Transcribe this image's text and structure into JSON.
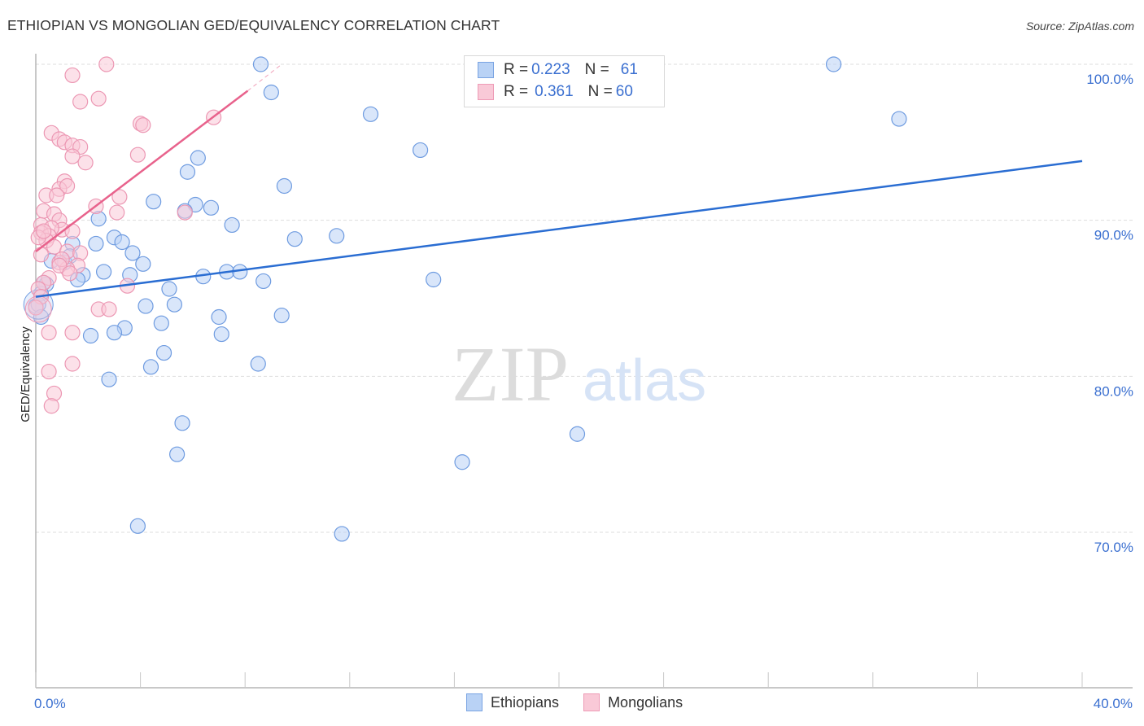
{
  "header": {
    "title": "ETHIOPIAN VS MONGOLIAN GED/EQUIVALENCY CORRELATION CHART",
    "source": "Source: ZipAtlas.com"
  },
  "watermark": {
    "zip": "ZIP",
    "atlas": "atlas"
  },
  "legend": {
    "rows": [
      {
        "r_label": "R = ",
        "r_value": "0.223",
        "n_label": "N = ",
        "n_value": "61"
      },
      {
        "r_label": "R = ",
        "r_value": "0.361",
        "n_label": "N = ",
        "n_value": "60"
      }
    ]
  },
  "colors": {
    "ethiopians_fill": "#b9d2f5",
    "ethiopians_stroke": "#6e9be0",
    "ethiopians_line": "#2a6dd2",
    "mongolians_fill": "#f9c9d7",
    "mongolians_stroke": "#ec97b3",
    "mongolians_line": "#e8628c",
    "axis_text": "#3a6fd0",
    "grid": "#dddddd"
  },
  "chart_data": {
    "type": "scatter",
    "title": "ETHIOPIAN VS MONGOLIAN GED/EQUIVALENCY CORRELATION CHART",
    "xlabel": "",
    "ylabel": "GED/Equivalency",
    "xlim": [
      0,
      40
    ],
    "ylim": [
      60.7,
      101.2
    ],
    "x_tick_labels": [
      {
        "value": 0,
        "label": "0.0%"
      },
      {
        "value": 40,
        "label": "40.0%"
      }
    ],
    "x_minor_ticks": [
      0,
      4,
      8,
      12,
      16,
      20,
      24,
      28,
      32,
      36,
      40
    ],
    "y_ticks": [
      {
        "value": 100,
        "label": "100.0%"
      },
      {
        "value": 90,
        "label": "90.0%"
      },
      {
        "value": 80,
        "label": "80.0%"
      },
      {
        "value": 70,
        "label": "70.0%"
      }
    ],
    "grid": true,
    "legend_position": "top-center",
    "bottom_legend": [
      "Ethiopians",
      "Mongolians"
    ],
    "series": [
      {
        "name": "Ethiopians",
        "R": 0.223,
        "N": 61,
        "trend": {
          "x": [
            0,
            40
          ],
          "y": [
            85.1,
            93.8
          ]
        },
        "points": [
          [
            8.6,
            100.0
          ],
          [
            9.0,
            98.2
          ],
          [
            12.8,
            96.8
          ],
          [
            30.5,
            100.0
          ],
          [
            33.0,
            96.5
          ],
          [
            14.7,
            94.5
          ],
          [
            6.2,
            94.0
          ],
          [
            5.8,
            93.1
          ],
          [
            9.5,
            92.2
          ],
          [
            4.5,
            91.2
          ],
          [
            6.1,
            91.0
          ],
          [
            5.7,
            90.6
          ],
          [
            6.7,
            90.8
          ],
          [
            2.4,
            90.1
          ],
          [
            7.5,
            89.7
          ],
          [
            9.9,
            88.8
          ],
          [
            11.5,
            89.0
          ],
          [
            3.0,
            88.9
          ],
          [
            3.3,
            88.6
          ],
          [
            2.3,
            88.5
          ],
          [
            1.4,
            88.5
          ],
          [
            3.7,
            87.9
          ],
          [
            4.1,
            87.2
          ],
          [
            0.6,
            87.4
          ],
          [
            1.1,
            87.3
          ],
          [
            1.8,
            86.5
          ],
          [
            2.6,
            86.7
          ],
          [
            3.6,
            86.5
          ],
          [
            1.6,
            86.2
          ],
          [
            6.4,
            86.4
          ],
          [
            7.3,
            86.7
          ],
          [
            7.8,
            86.7
          ],
          [
            8.7,
            86.1
          ],
          [
            15.2,
            86.2
          ],
          [
            0.4,
            85.9
          ],
          [
            0.2,
            85.3
          ],
          [
            5.1,
            85.6
          ],
          [
            0.0,
            84.5
          ],
          [
            4.2,
            84.5
          ],
          [
            5.3,
            84.6
          ],
          [
            4.8,
            83.4
          ],
          [
            7.0,
            83.8
          ],
          [
            9.4,
            83.9
          ],
          [
            3.4,
            83.1
          ],
          [
            3.0,
            82.8
          ],
          [
            2.1,
            82.6
          ],
          [
            7.1,
            82.7
          ],
          [
            4.9,
            81.5
          ],
          [
            8.5,
            80.8
          ],
          [
            4.4,
            80.6
          ],
          [
            2.8,
            79.8
          ],
          [
            5.6,
            77.0
          ],
          [
            5.4,
            75.0
          ],
          [
            16.3,
            74.5
          ],
          [
            20.7,
            76.3
          ],
          [
            3.9,
            70.4
          ],
          [
            11.7,
            69.9
          ],
          [
            0.1,
            84.6
          ],
          [
            0.2,
            83.8
          ],
          [
            0.3,
            86.0
          ],
          [
            1.3,
            87.7
          ]
        ]
      },
      {
        "name": "Mongolians",
        "R": 0.361,
        "N": 60,
        "trend": {
          "x": [
            0,
            8.1
          ],
          "y": [
            88.0,
            98.3
          ]
        },
        "trend_dashed": {
          "x": [
            8.1,
            9.4
          ],
          "y": [
            98.3,
            100.0
          ]
        },
        "points": [
          [
            1.4,
            99.3
          ],
          [
            2.7,
            100.0
          ],
          [
            2.4,
            97.8
          ],
          [
            1.7,
            97.6
          ],
          [
            4.0,
            96.2
          ],
          [
            4.1,
            96.1
          ],
          [
            6.8,
            96.6
          ],
          [
            0.6,
            95.6
          ],
          [
            0.9,
            95.2
          ],
          [
            1.1,
            95.0
          ],
          [
            1.4,
            94.8
          ],
          [
            1.7,
            94.7
          ],
          [
            3.9,
            94.2
          ],
          [
            1.4,
            94.1
          ],
          [
            1.9,
            93.7
          ],
          [
            1.1,
            92.5
          ],
          [
            0.9,
            92.0
          ],
          [
            1.2,
            92.2
          ],
          [
            0.4,
            91.6
          ],
          [
            0.8,
            91.6
          ],
          [
            3.2,
            91.5
          ],
          [
            2.3,
            90.9
          ],
          [
            3.1,
            90.5
          ],
          [
            0.3,
            90.6
          ],
          [
            0.7,
            90.4
          ],
          [
            0.9,
            90.0
          ],
          [
            0.2,
            89.7
          ],
          [
            1.0,
            89.4
          ],
          [
            0.6,
            89.5
          ],
          [
            0.2,
            89.2
          ],
          [
            0.5,
            89.0
          ],
          [
            1.4,
            89.3
          ],
          [
            0.4,
            88.7
          ],
          [
            0.7,
            88.3
          ],
          [
            0.2,
            87.8
          ],
          [
            1.2,
            88.0
          ],
          [
            1.7,
            87.9
          ],
          [
            0.9,
            87.3
          ],
          [
            1.6,
            87.1
          ],
          [
            1.2,
            86.9
          ],
          [
            1.0,
            87.5
          ],
          [
            0.5,
            86.3
          ],
          [
            0.3,
            86.0
          ],
          [
            0.1,
            85.6
          ],
          [
            0.2,
            85.1
          ],
          [
            0.0,
            84.4
          ],
          [
            2.4,
            84.3
          ],
          [
            2.8,
            84.3
          ],
          [
            1.4,
            82.8
          ],
          [
            0.5,
            82.8
          ],
          [
            0.5,
            80.3
          ],
          [
            1.4,
            80.8
          ],
          [
            0.7,
            78.9
          ],
          [
            0.6,
            78.1
          ],
          [
            3.5,
            85.8
          ],
          [
            5.7,
            90.5
          ],
          [
            0.1,
            88.9
          ],
          [
            0.3,
            89.3
          ],
          [
            0.9,
            87.1
          ],
          [
            1.3,
            86.6
          ]
        ]
      }
    ]
  }
}
